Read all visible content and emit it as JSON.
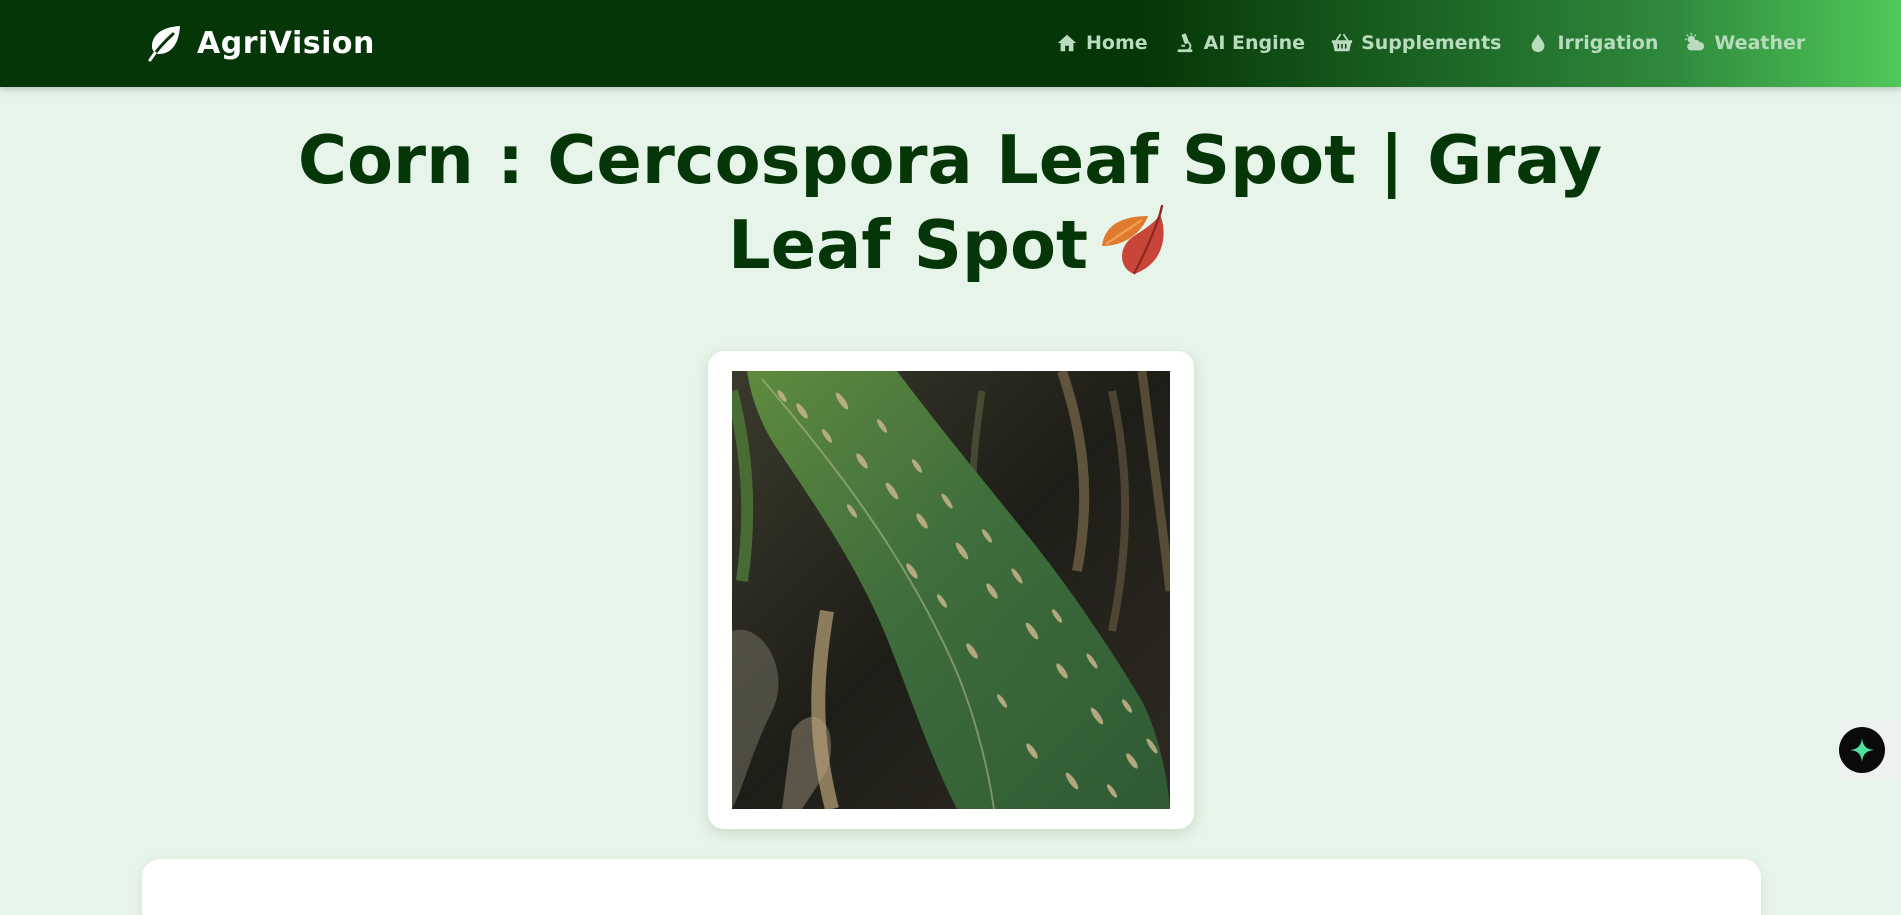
{
  "navbar": {
    "brand": {
      "name": "AgriVision",
      "icon": "leaf-icon"
    },
    "links": [
      {
        "label": "Home",
        "icon": "home-icon"
      },
      {
        "label": "AI Engine",
        "icon": "microscope-icon"
      },
      {
        "label": "Supplements",
        "icon": "basket-icon"
      },
      {
        "label": "Irrigation",
        "icon": "droplet-icon"
      },
      {
        "label": "Weather",
        "icon": "cloud-sun-icon"
      }
    ]
  },
  "main": {
    "title": "Corn : Cercospora Leaf Spot | Gray Leaf Spot",
    "title_emoji": "fallen-leaves-icon",
    "image": {
      "subject": "leaf-photo"
    }
  },
  "assistant": {
    "icon": "sparkle-icon"
  },
  "colors": {
    "nav_dark": "#053607",
    "nav_light": "#50c85a",
    "page_bg": "#e6f4e9",
    "title": "#053607",
    "nav_text": "#b9dcbe"
  }
}
